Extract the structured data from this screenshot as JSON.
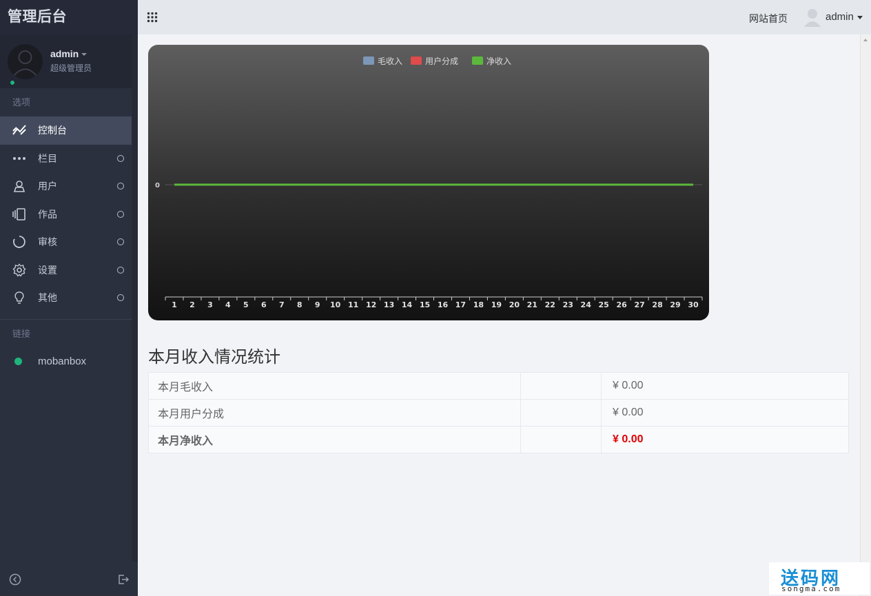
{
  "app": {
    "title": "管理后台"
  },
  "user": {
    "name": "admin",
    "role": "超级管理员"
  },
  "sidebar": {
    "section_options": "选项",
    "items": [
      {
        "label": "控制台",
        "icon": "trend-icon",
        "active": true
      },
      {
        "label": "栏目",
        "icon": "more-dots-icon"
      },
      {
        "label": "用户",
        "icon": "user-icon"
      },
      {
        "label": "作品",
        "icon": "works-icon"
      },
      {
        "label": "审核",
        "icon": "loading-ring-icon"
      },
      {
        "label": "设置",
        "icon": "gear-icon"
      },
      {
        "label": "其他",
        "icon": "bulb-icon"
      }
    ],
    "section_links": "链接",
    "links": [
      {
        "label": "mobanbox",
        "color": "#1eb57c"
      }
    ]
  },
  "topbar": {
    "site_link": "网站首页",
    "user_name": "admin"
  },
  "chart_data": {
    "type": "line",
    "legend": [
      "毛收入",
      "用户分成",
      "净收入"
    ],
    "legend_colors": [
      "#7c97b8",
      "#e04b4b",
      "#5cb83c"
    ],
    "x": [
      1,
      2,
      3,
      4,
      5,
      6,
      7,
      8,
      9,
      10,
      11,
      12,
      13,
      14,
      15,
      16,
      17,
      18,
      19,
      20,
      21,
      22,
      23,
      24,
      25,
      26,
      27,
      28,
      29,
      30
    ],
    "series": [
      {
        "name": "毛收入",
        "values": [
          0,
          0,
          0,
          0,
          0,
          0,
          0,
          0,
          0,
          0,
          0,
          0,
          0,
          0,
          0,
          0,
          0,
          0,
          0,
          0,
          0,
          0,
          0,
          0,
          0,
          0,
          0,
          0,
          0,
          0
        ]
      },
      {
        "name": "用户分成",
        "values": [
          0,
          0,
          0,
          0,
          0,
          0,
          0,
          0,
          0,
          0,
          0,
          0,
          0,
          0,
          0,
          0,
          0,
          0,
          0,
          0,
          0,
          0,
          0,
          0,
          0,
          0,
          0,
          0,
          0,
          0
        ]
      },
      {
        "name": "净收入",
        "values": [
          0,
          0,
          0,
          0,
          0,
          0,
          0,
          0,
          0,
          0,
          0,
          0,
          0,
          0,
          0,
          0,
          0,
          0,
          0,
          0,
          0,
          0,
          0,
          0,
          0,
          0,
          0,
          0,
          0,
          0
        ]
      }
    ],
    "y_ticks": [
      0
    ],
    "legend_position": "top-center"
  },
  "stats": {
    "title": "本月收入情况统计",
    "rows": [
      {
        "label": "本月毛收入",
        "value": "¥ 0.00"
      },
      {
        "label": "本月用户分成",
        "value": "¥ 0.00"
      },
      {
        "label": "本月净收入",
        "value": "¥ 0.00"
      }
    ]
  },
  "watermark": {
    "big": "送码网",
    "small": "songma.com"
  }
}
